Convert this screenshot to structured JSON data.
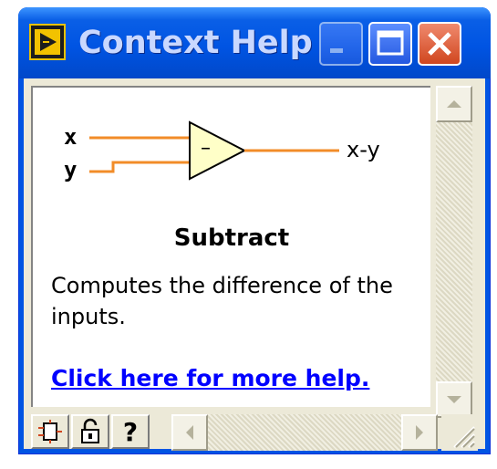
{
  "window": {
    "title": "Context Help"
  },
  "diagram": {
    "input_x": "x",
    "input_y": "y",
    "output": "x-y",
    "operator_symbol": "–",
    "wire_color": "#f28c28",
    "triangle_fill": "#ffffc8"
  },
  "help": {
    "title": "Subtract",
    "description": "Computes the difference of the inputs.",
    "link": "Click here for more help."
  },
  "toolbar": {
    "help_button": "?"
  },
  "colors": {
    "titlebar": "#0054e3",
    "close_button": "#d0461f",
    "link": "#0000ff"
  },
  "icons": {
    "app": "labview-function-icon",
    "minimize": "minimize-icon",
    "maximize": "maximize-icon",
    "close": "close-icon",
    "show_terminals": "show-terminals-icon",
    "lock": "lock-icon",
    "help": "question-mark-icon",
    "scroll_up": "arrow-up-icon",
    "scroll_down": "arrow-down-icon",
    "scroll_left": "arrow-left-icon",
    "scroll_right": "arrow-right-icon",
    "resize_grip": "resize-grip-icon"
  }
}
